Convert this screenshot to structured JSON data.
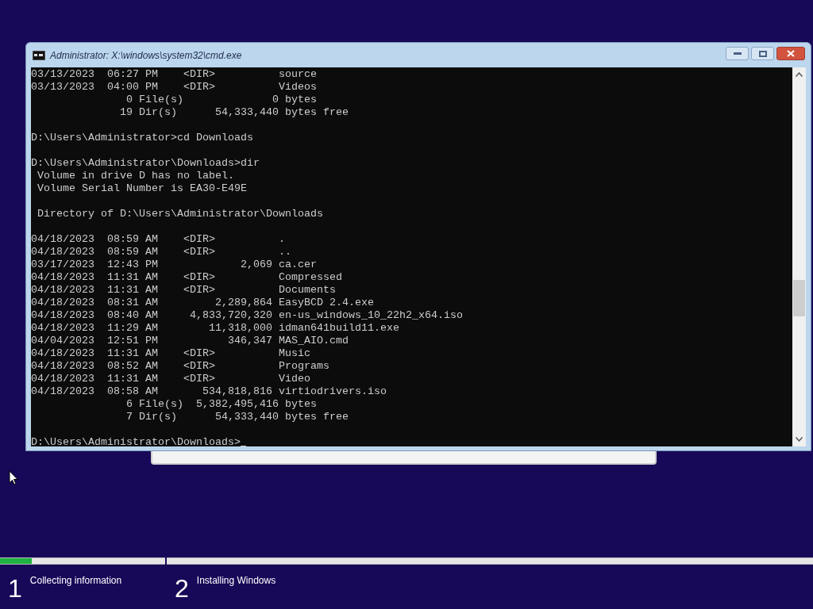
{
  "window": {
    "title": "Administrator: X:\\windows\\system32\\cmd.exe"
  },
  "console": {
    "blocks": [
      [
        "03/13/2023  06:27 PM    <DIR>          source",
        "03/13/2023  04:00 PM    <DIR>          Videos",
        "               0 File(s)              0 bytes",
        "              19 Dir(s)      54,333,440 bytes free"
      ],
      [
        "D:\\Users\\Administrator>cd Downloads"
      ],
      [
        "D:\\Users\\Administrator\\Downloads>dir",
        " Volume in drive D has no label.",
        " Volume Serial Number is EA30-E49E"
      ],
      [
        " Directory of D:\\Users\\Administrator\\Downloads"
      ],
      [
        "04/18/2023  08:59 AM    <DIR>          .",
        "04/18/2023  08:59 AM    <DIR>          ..",
        "03/17/2023  12:43 PM             2,069 ca.cer",
        "04/18/2023  11:31 AM    <DIR>          Compressed",
        "04/18/2023  11:31 AM    <DIR>          Documents",
        "04/18/2023  08:31 AM         2,289,864 EasyBCD 2.4.exe",
        "04/18/2023  08:40 AM     4,833,720,320 en-us_windows_10_22h2_x64.iso",
        "04/18/2023  11:29 AM        11,318,000 idman641build11.exe",
        "04/04/2023  12:51 PM           346,347 MAS_AIO.cmd",
        "04/18/2023  11:31 AM    <DIR>          Music",
        "04/18/2023  08:52 AM    <DIR>          Programs",
        "04/18/2023  11:31 AM    <DIR>          Video",
        "04/18/2023  08:58 AM       534,818,816 virtiodrivers.iso",
        "               6 File(s)  5,382,495,416 bytes",
        "               7 Dir(s)      54,333,440 bytes free"
      ]
    ],
    "prompt": {
      "text": "D:\\Users\\Administrator\\Downloads>",
      "cursor": true
    }
  },
  "setup_progress": {
    "steps": [
      {
        "number": "1",
        "label": "Collecting information",
        "level": 0.19
      },
      {
        "number": "2",
        "label": "Installing Windows",
        "level": 0
      }
    ]
  }
}
